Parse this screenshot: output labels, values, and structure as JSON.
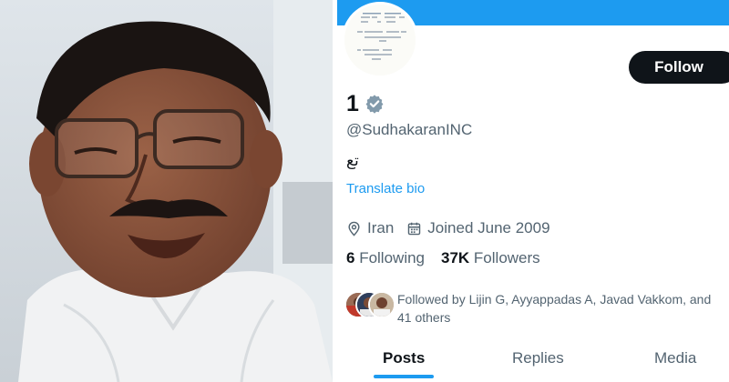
{
  "profile": {
    "name": "1",
    "handle": "@SudhakaranINC",
    "bio": "تع",
    "translate_label": "Translate bio",
    "follow_label": "Follow",
    "location": "Iran",
    "joined": "Joined June 2009",
    "following_count": "6",
    "following_label": " Following",
    "followers_count": "37K",
    "followers_label": " Followers",
    "followed_by_text": "Followed by Lijin G, Ayyappadas A, Javad Vakkom, and 41 others"
  },
  "tabs": [
    "Posts",
    "Replies",
    "Media"
  ],
  "active_tab": "Posts",
  "icons": {
    "verified": "verified-badge-icon",
    "location": "location-pin-icon",
    "calendar": "calendar-icon"
  },
  "colors": {
    "accent": "#1d9bf0",
    "text_primary": "#0f1419",
    "text_secondary": "#536471",
    "follow_button": "#0f1419",
    "verified_badge": "#829aab"
  }
}
